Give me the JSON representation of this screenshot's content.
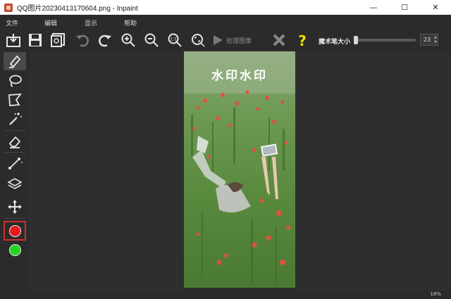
{
  "window": {
    "title": "QQ图片20230413170604.png - Inpaint",
    "controls": {
      "minimize": "—",
      "maximize": "☐",
      "close": "✕"
    }
  },
  "menu": {
    "items": [
      "文件",
      "编辑",
      "显示",
      "帮助"
    ]
  },
  "toolbar": {
    "buttons": [
      "open-icon",
      "save-icon",
      "save-as-icon",
      "undo-icon",
      "redo-icon",
      "zoom-in-icon",
      "zoom-out-icon",
      "actual-size-icon",
      "fit-icon"
    ],
    "process_label": "处理图像",
    "brush_size_label": "魔术笔大小",
    "brush_size_value": "23",
    "brush_size_level": 0.02
  },
  "tools": [
    "marker-icon",
    "lasso-icon",
    "polygon-lasso-icon",
    "magic-wand-icon",
    "eraser-icon",
    "line-icon",
    "layers-icon",
    "move-icon"
  ],
  "colors": {
    "selection_red": "#e8191c",
    "donor_green": "#26d426",
    "highlight_border": "#d03030"
  },
  "canvas": {
    "watermark_text": "水印水印"
  },
  "status": {
    "zoom": "18%"
  }
}
